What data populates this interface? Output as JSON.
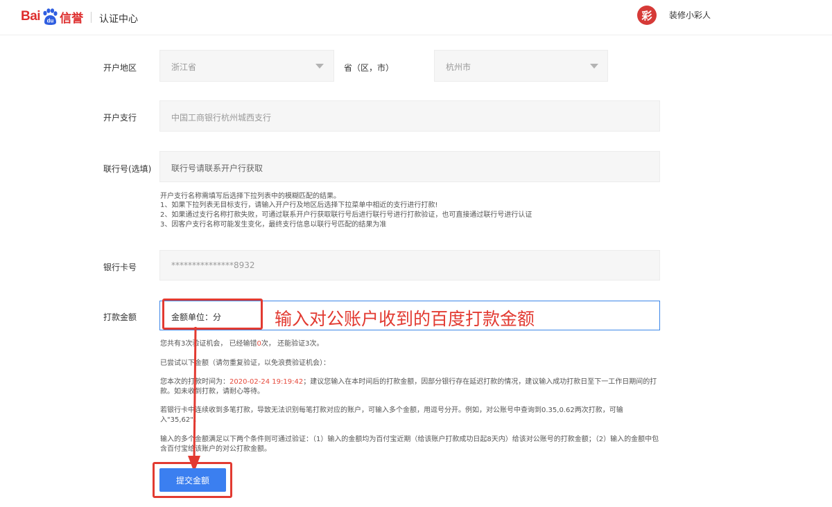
{
  "header": {
    "logo_bai": "Bai",
    "logo_xinyu": "信誉",
    "title": "认证中心",
    "avatar_char": "彩",
    "username": "装修小彩人"
  },
  "form": {
    "region_label": "开户地区",
    "province_value": "浙江省",
    "province_suffix": "省（区，市）",
    "city_value": "杭州市",
    "branch_label": "开户支行",
    "branch_value": "中国工商银行杭州城西支行",
    "bank_code_label": "联行号(选填)",
    "bank_code_placeholder": "联行号请联系开户行获取",
    "hints": [
      "开户支行名称需填写后选择下拉列表中的模糊匹配的结果。",
      "1、如果下拉列表无目标支行，请输入开户行及地区后选择下拉菜单中相近的支行进行打款!",
      "2、如果通过支行名称打款失败，可通过联系开户行获取联行号后进行联行号进行打款验证，也可直接通过联行号进行认证",
      "3、因客户支行名称可能发生变化，最终支行信息以联行号匹配的结果为准"
    ],
    "card_label": "银行卡号",
    "card_value": "***************8932",
    "amount_label": "打款金额",
    "amount_placeholder": "金额单位：分"
  },
  "annotation": "输入对公账户收到的百度打款金额",
  "info": {
    "attempts_pre": "您共有3次验证机会，  已经输错",
    "attempts_wrong": "0",
    "attempts_post": "次，  还能验证3次。",
    "tried": "已尝试以下金额（请勿重复验证，以免浪费验证机会）：",
    "time_pre": "您本次的打款时间为：",
    "time_value": "2020-02-24 19:19:42",
    "time_post": "；建议您输入在本时间后的打款金额，因部分银行存在延迟打款的情况，建议输入成功打款日至下一工作日期间的打款。如未收到打款，请耐心等待。",
    "multi": "若银行卡中连续收到多笔打款，导致无法识别每笔打款对应的账户，可输入多个金额，用逗号分开。例如，对公账号中查询到0.35,0.62两次打款，可输入\"35,62\"。",
    "conditions": "输入的多个金额满足以下两个条件则可通过验证：（1）输入的金额均为百付宝近期（给该账户打款成功日起8天内）给该对公账号的打款金额；（2）输入的金额中包含百付宝给该账户的对公打款金额。"
  },
  "submit_label": "提交金额",
  "colors": {
    "brand_red": "#de2e2e",
    "annotation_red": "#e23a31",
    "primary_blue": "#3b7ff0"
  }
}
